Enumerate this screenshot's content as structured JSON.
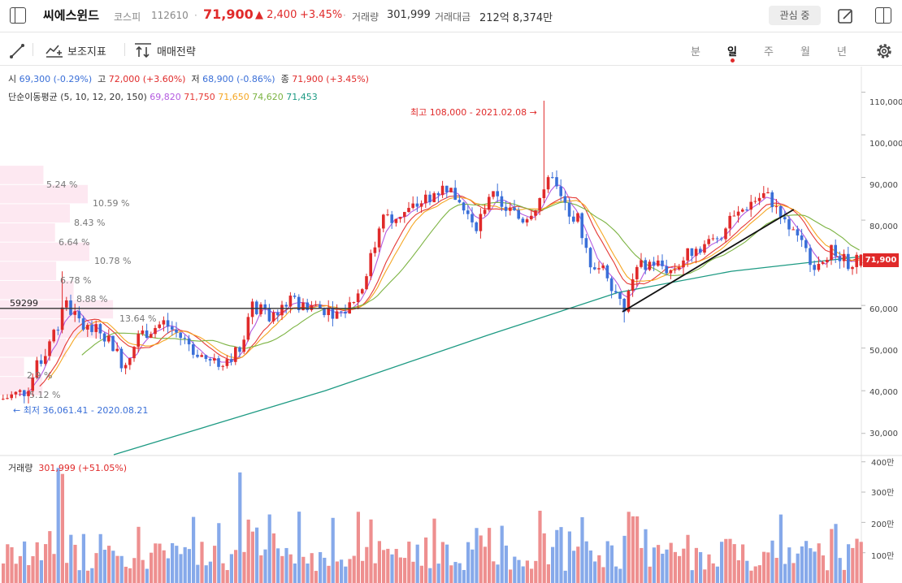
{
  "header": {
    "stock_name": "씨에스윈드",
    "market": "코스피",
    "code": "112610",
    "price": "71,900",
    "change": "▲ 2,400",
    "change_pct": "+3.45%",
    "volume_label": "거래량",
    "volume": "301,999",
    "amount_label": "거래대금",
    "amount": "212억 8,374만",
    "watch_button": "관심 중"
  },
  "toolbar": {
    "indicators_label": "보조지표",
    "strategy_label": "매매전략",
    "periods": [
      "분",
      "일",
      "주",
      "월",
      "년"
    ],
    "active_period": "일"
  },
  "legend": {
    "open_label": "시",
    "open": "69,300 (-0.29%)",
    "high_label": "고",
    "high": "72,000 (+3.60%)",
    "low_label": "저",
    "low": "68,900 (-0.86%)",
    "close_label": "종",
    "close": "71,900 (+3.45%)",
    "ma_label": "단순이동평균 (5, 10, 12, 20, 150)",
    "ma_values": [
      "69,820",
      "71,750",
      "71,650",
      "74,620",
      "71,453"
    ],
    "ma_colors": [
      "#b45be0",
      "#e53935",
      "#f5a623",
      "#7cb342",
      "#1d9a83"
    ],
    "volume_label": "거래량",
    "volume_value": "301,999 (+51.05%)"
  },
  "annotations": {
    "high": "최고 108,000 - 2021.02.08 →",
    "low": "← 최저 36,061.41 - 2020.08.21",
    "level": "59299",
    "current_price_tag": "71,900"
  },
  "colors": {
    "up": "#e02a2a",
    "down": "#3a6fd8",
    "up_vol": "#ee8f8f",
    "down_vol": "#86a9ea"
  },
  "chart_data": {
    "type": "candlestick",
    "y_ticks": [
      "110,000",
      "100,000",
      "90,000",
      "80,000",
      "70,000",
      "60,000",
      "50,000",
      "40,000",
      "30,000"
    ],
    "y_tick_values": [
      110000,
      100000,
      90000,
      80000,
      70000,
      60000,
      50000,
      40000,
      30000
    ],
    "ylim": [
      25000,
      116000
    ],
    "volume_ticks": [
      "400만",
      "300만",
      "200만",
      "100만"
    ],
    "volume_tick_values": [
      400,
      300,
      200,
      100
    ],
    "vol_ylim": [
      0,
      410
    ],
    "volume_profile": [
      {
        "label": "5.24 %",
        "pct": 5.24,
        "price": 90500
      },
      {
        "label": "10.59 %",
        "pct": 10.59,
        "price": 86000
      },
      {
        "label": "8.43 %",
        "pct": 8.43,
        "price": 81500
      },
      {
        "label": "6.64 %",
        "pct": 6.64,
        "price": 77000
      },
      {
        "label": "10.78 %",
        "pct": 10.78,
        "price": 72500
      },
      {
        "label": "6.78 %",
        "pct": 6.78,
        "price": 68000
      },
      {
        "label": "8.88 %",
        "pct": 8.88,
        "price": 63500
      },
      {
        "label": "13.64 %",
        "pct": 13.64,
        "price": 59000
      },
      {
        "label": "",
        "pct": 12.2,
        "price": 54500
      },
      {
        "label": "",
        "pct": 8.0,
        "price": 50000
      },
      {
        "label": "2.9 %",
        "pct": 2.9,
        "price": 45500
      },
      {
        "label": "5.12 %",
        "pct": 5.12,
        "price": 41000
      }
    ],
    "horizontal_line": 59299,
    "trendline": [
      [
        0.69,
        58500
      ],
      [
        0.88,
        82500
      ]
    ],
    "high": 108000,
    "low": 36061.41
  }
}
